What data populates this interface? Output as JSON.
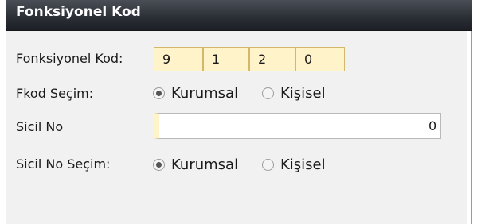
{
  "panel": {
    "title": "Fonksiyonel Kod"
  },
  "form": {
    "fonksiyonel_kod": {
      "label": "Fonksiyonel Kod:",
      "digits": [
        "9",
        "1",
        "2",
        "0"
      ]
    },
    "fkod_secim": {
      "label": "Fkod Seçim:",
      "options": [
        {
          "label": "Kurumsal",
          "selected": true
        },
        {
          "label": "Kişisel",
          "selected": false
        }
      ]
    },
    "sicil_no": {
      "label": "Sicil No",
      "value": "",
      "tail_char": "0"
    },
    "sicil_no_secim": {
      "label": "Sicil No Seçim:",
      "options": [
        {
          "label": "Kurumsal",
          "selected": true
        },
        {
          "label": "Kişisel",
          "selected": false
        }
      ]
    }
  },
  "colors": {
    "header_bg": "#2c3037",
    "header_text": "#ffffff",
    "panel_bg": "#f1f1f1",
    "code_box_bg": "#fff3c9",
    "code_box_border": "#d4b86a"
  },
  "icons": [
    "radio-selected-icon",
    "radio-unselected-icon"
  ]
}
